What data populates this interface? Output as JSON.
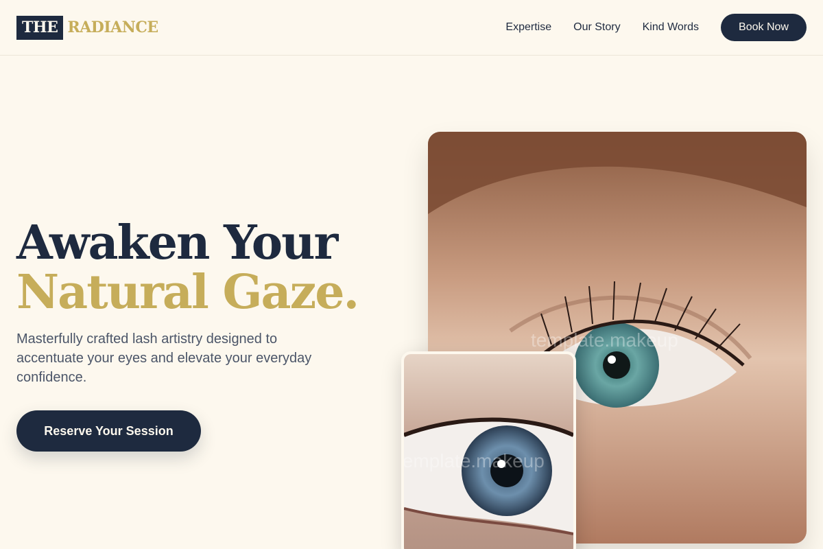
{
  "brand": {
    "logo_box": "THE",
    "logo_rest": "RADIANCE"
  },
  "nav": {
    "links": [
      "Expertise",
      "Our Story",
      "Kind Words"
    ],
    "book_label": "Book Now"
  },
  "hero": {
    "title_line1": "Awaken Your",
    "title_line2": "Natural Gaze.",
    "subtitle": "Masterfully crafted lash artistry designed to accentuate your eyes and elevate your everyday confidence.",
    "cta_label": "Reserve Your Session"
  },
  "images": {
    "main_watermark": "template.makeup",
    "small_watermark": "template.makeup"
  },
  "colors": {
    "background": "#fdf8ee",
    "navy": "#1e2a3f",
    "gold": "#c6ad5a",
    "body_text": "#4b5568"
  }
}
